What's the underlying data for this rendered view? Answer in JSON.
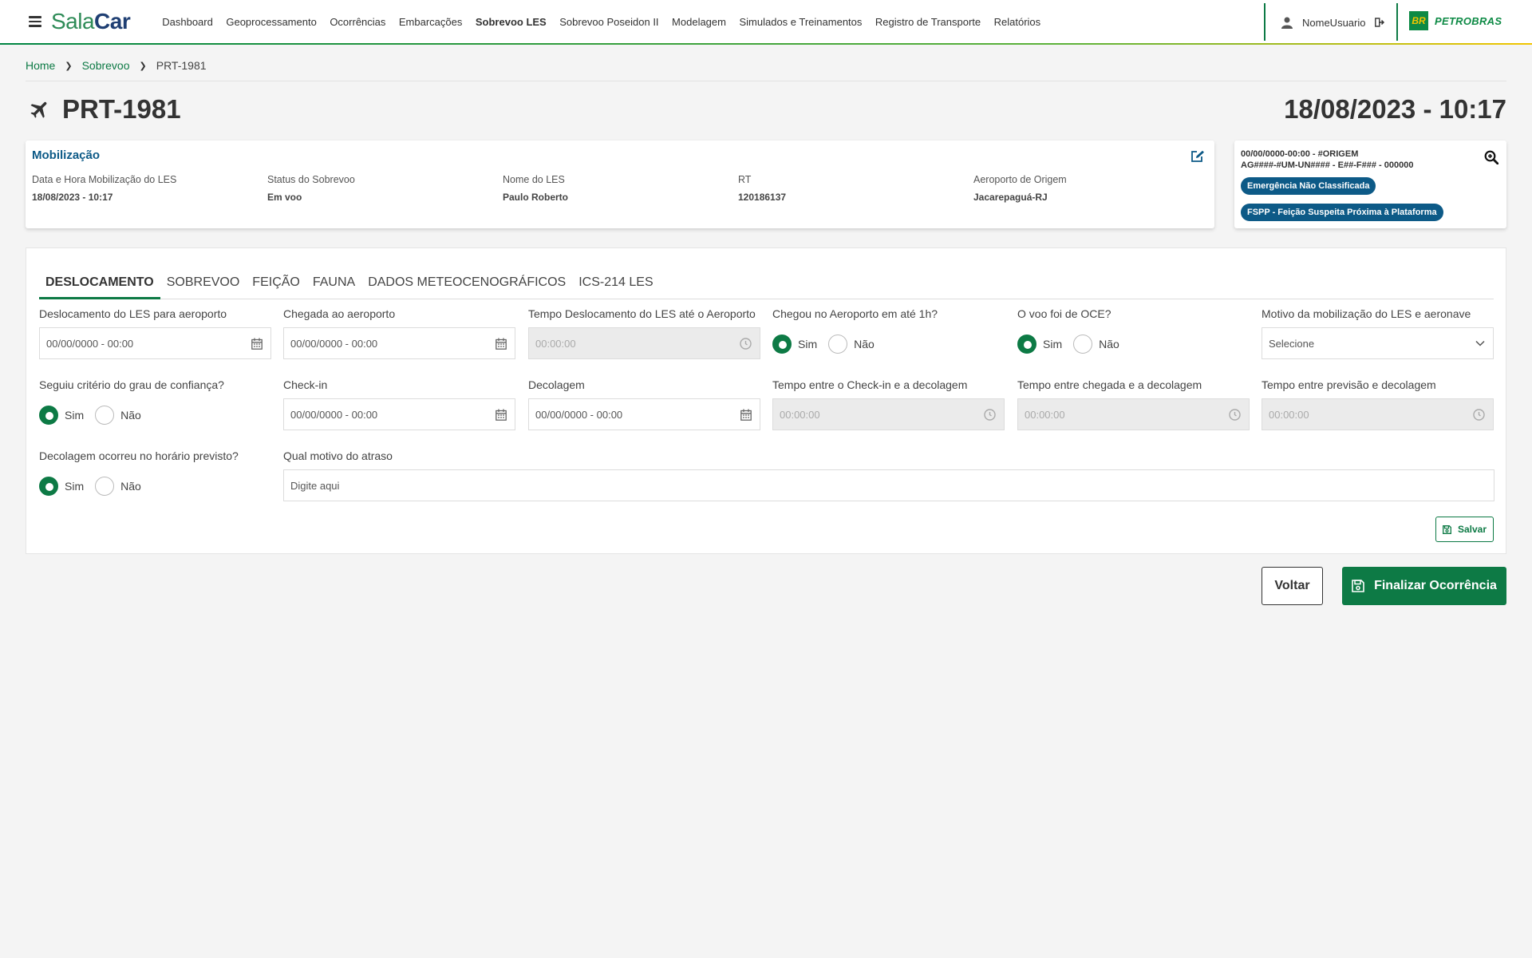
{
  "app": {
    "logo_part1": "Sala",
    "logo_part2": "Car"
  },
  "nav": [
    "Dashboard",
    "Geoprocessamento",
    "Ocorrências",
    "Embarcações",
    "Sobrevoo LES",
    "Sobrevoo Poseidon II",
    "Modelagem",
    "Simulados e Treinamentos",
    "Registro de Transporte",
    "Relatórios"
  ],
  "nav_active": "Sobrevoo LES",
  "user": {
    "name": "NomeUsuario"
  },
  "brand": {
    "mark": "BR",
    "name": "PETROBRAS"
  },
  "breadcrumb": {
    "home": "Home",
    "section": "Sobrevoo",
    "current": "PRT-1981"
  },
  "page": {
    "title": "PRT-1981",
    "datetime": "18/08/2023 - 10:17"
  },
  "mobilizacao": {
    "title": "Mobilização",
    "fields": [
      {
        "label": "Data e Hora Mobilização do LES",
        "value": "18/08/2023 - 10:17"
      },
      {
        "label": "Status do Sobrevoo",
        "value": "Em voo"
      },
      {
        "label": "Nome do LES",
        "value": "Paulo Roberto"
      },
      {
        "label": "RT",
        "value": "120186137"
      },
      {
        "label": "Aeroporto de Origem",
        "value": "Jacarepaguá-RJ"
      }
    ]
  },
  "side": {
    "line1": "00/00/0000-00:00 - #ORIGEM",
    "line2": "AG####-#UM-UN#### - E##-F### - 000000",
    "badges": [
      "Emergência Não Classificada",
      "FSPP - Feição Suspeita Próxima à Plataforma"
    ]
  },
  "tabs": [
    "DESLOCAMENTO",
    "SOBREVOO",
    "FEIÇÃO",
    "FAUNA",
    "DADOS METEOCENOGRÁFICOS",
    "ICS-214 LES"
  ],
  "form": {
    "desloc_label": "Deslocamento do LES para aeroporto",
    "desloc_value": "00/00/0000 - 00:00",
    "chegada_label": "Chegada ao aeroporto",
    "chegada_value": "00/00/0000 - 00:00",
    "tempo_desloc_label": "Tempo Deslocamento do LES até o Aeroporto",
    "tempo_desloc_value": "00:00:00",
    "chegou_label": "Chegou no Aeroporto em até 1h?",
    "oce_label": "O voo foi de OCE?",
    "motivo_label": "Motivo da mobilização do LES e aeronave",
    "motivo_value": "Selecione",
    "criterio_label": "Seguiu critério do grau de confiança?",
    "checkin_label": "Check-in",
    "checkin_value": "00/00/0000 - 00:00",
    "decolagem_label": "Decolagem",
    "decolagem_value": "00/00/0000 - 00:00",
    "t_checkin_label": "Tempo entre o Check-in e a decolagem",
    "t_checkin_value": "00:00:00",
    "t_chegada_label": "Tempo entre chegada e a decolagem",
    "t_chegada_value": "00:00:00",
    "t_previsao_label": "Tempo entre previsão e decolagem",
    "t_previsao_value": "00:00:00",
    "horario_label": "Decolagem ocorreu no horário previsto?",
    "atraso_label": "Qual motivo do atraso",
    "atraso_placeholder": "Digite aqui",
    "sim": "Sim",
    "nao": "Não"
  },
  "buttons": {
    "salvar": "Salvar",
    "voltar": "Voltar",
    "finalizar": "Finalizar Ocorrência"
  },
  "colors": {
    "primary_green": "#0d7a45",
    "badge_blue": "#0d5a87"
  }
}
